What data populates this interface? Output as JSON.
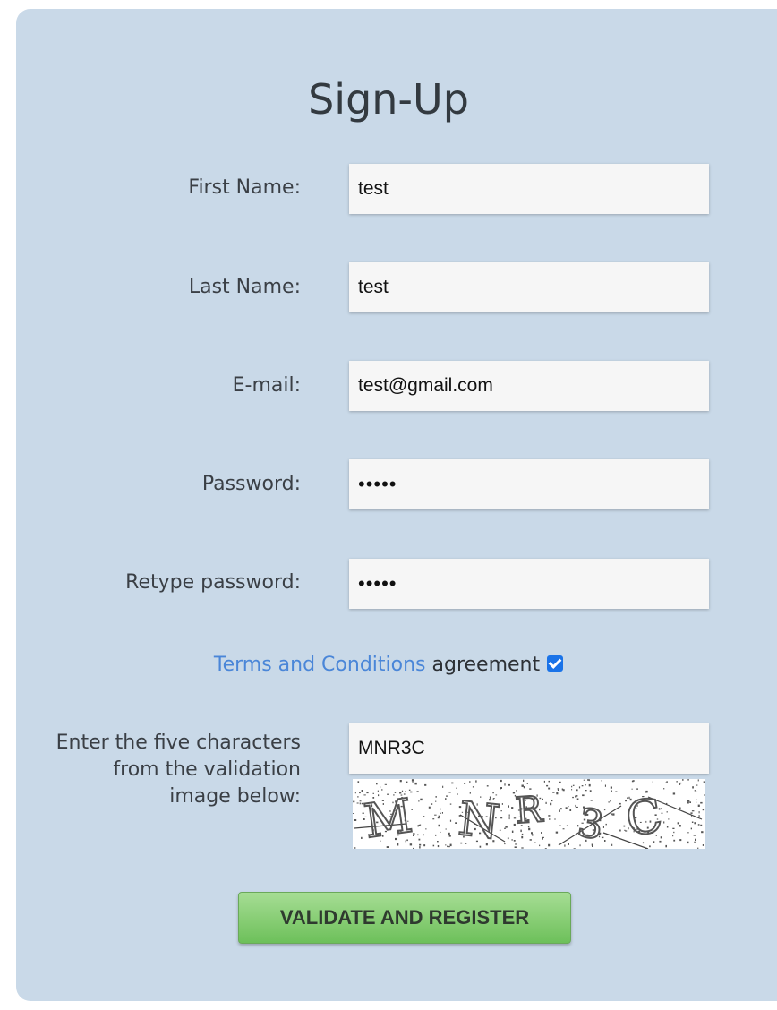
{
  "form": {
    "title": "Sign-Up",
    "first_name": {
      "label": "First Name:",
      "value": "test"
    },
    "last_name": {
      "label": "Last Name:",
      "value": "test"
    },
    "email": {
      "label": "E-mail:",
      "value": "test@gmail.com"
    },
    "password": {
      "label": "Password:",
      "value": "•••••"
    },
    "retype_password": {
      "label": "Retype password:",
      "value": "•••••"
    },
    "terms": {
      "link_text": "Terms and Conditions",
      "suffix": " agreement",
      "checked": true
    },
    "captcha": {
      "label": "Enter the five characters from the validation image below:",
      "value": "MNR3C",
      "image_text": "MNR3C"
    },
    "submit_label": "VALIDATE AND REGISTER"
  }
}
